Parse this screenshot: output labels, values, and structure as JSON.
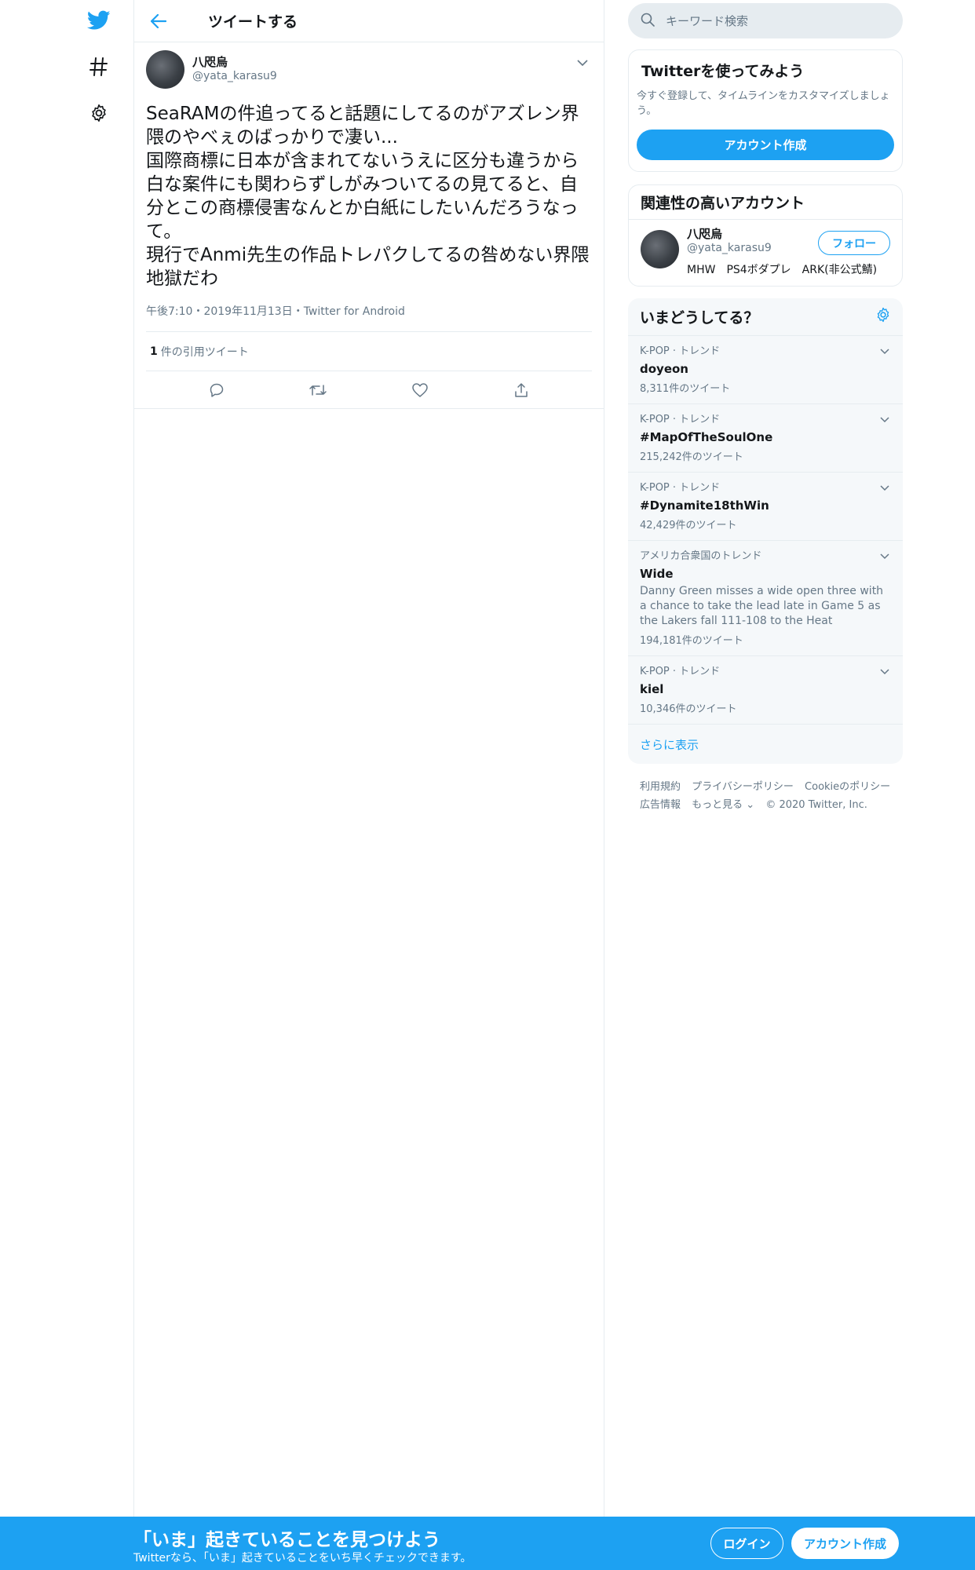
{
  "colors": {
    "accent": "#1da1f2",
    "text": "#14171a",
    "muted": "#657786",
    "border": "#e6ecf0",
    "panel": "#f5f8fa"
  },
  "icons": {
    "logo": "twitter-bird-icon",
    "explore": "hashtag-icon",
    "settings": "gear-icon"
  },
  "header": {
    "title": "ツイートする"
  },
  "tweet": {
    "display_name": "八咫烏",
    "handle": "@yata_karasu9",
    "body": "SeaRAMの件追ってると話題にしてるのがアズレン界隈のやべぇのばっかりで凄い...\n国際商標に日本が含まれてないうえに区分も違うから白な案件にも関わらずしがみついてるの見てると、自分とこの商標侵害なんとか白紙にしたいんだろうなって。\n現行でAnmi先生の作品トレパクしてるの咎めない界隈地獄だわ",
    "meta": "午後7:10・2019年11月13日・Twitter for Android",
    "quote_count": "1",
    "quote_label": "件の引用ツイート"
  },
  "search": {
    "placeholder": "キーワード検索"
  },
  "signup_card": {
    "title": "Twitterを使ってみよう",
    "description": "今すぐ登録して、タイムラインをカスタマイズしましょう。",
    "button": "アカウント作成"
  },
  "related": {
    "title": "関連性の高いアカウント",
    "user": {
      "display_name": "八咫烏",
      "handle": "@yata_karasu9",
      "description": "MHW　PS4ボダプレ　ARK(非公式鯖)",
      "follow_label": "フォロー"
    }
  },
  "trends": {
    "title": "いまどうしてる？",
    "items": [
      {
        "context": "K-POP · トレンド",
        "name": "doyeon",
        "description": "",
        "count": "8,311件のツイート"
      },
      {
        "context": "K-POP · トレンド",
        "name": "#MapOfTheSoulOne",
        "description": "",
        "count": "215,242件のツイート"
      },
      {
        "context": "K-POP · トレンド",
        "name": "#Dynamite18thWin",
        "description": "",
        "count": "42,429件のツイート"
      },
      {
        "context": "アメリカ合衆国のトレンド",
        "name": "Wide",
        "description": "Danny Green misses a wide open three with a chance to take the lead late in Game 5 as the Lakers fall 111-108 to the Heat",
        "count": "194,181件のツイート"
      },
      {
        "context": "K-POP · トレンド",
        "name": "kiel",
        "description": "",
        "count": "10,346件のツイート"
      }
    ],
    "show_more": "さらに表示"
  },
  "footer": {
    "terms": "利用規約",
    "privacy": "プライバシーポリシー",
    "cookies": "Cookieのポリシー",
    "ads": "広告情報",
    "more": "もっと見る ⌄",
    "copyright": "© 2020 Twitter, Inc."
  },
  "bottom_bar": {
    "title": "「いま」起きていることを見つけよう",
    "subtitle": "Twitterなら、「いま」起きていることをいち早くチェックできます。",
    "login": "ログイン",
    "signup": "アカウント作成"
  }
}
